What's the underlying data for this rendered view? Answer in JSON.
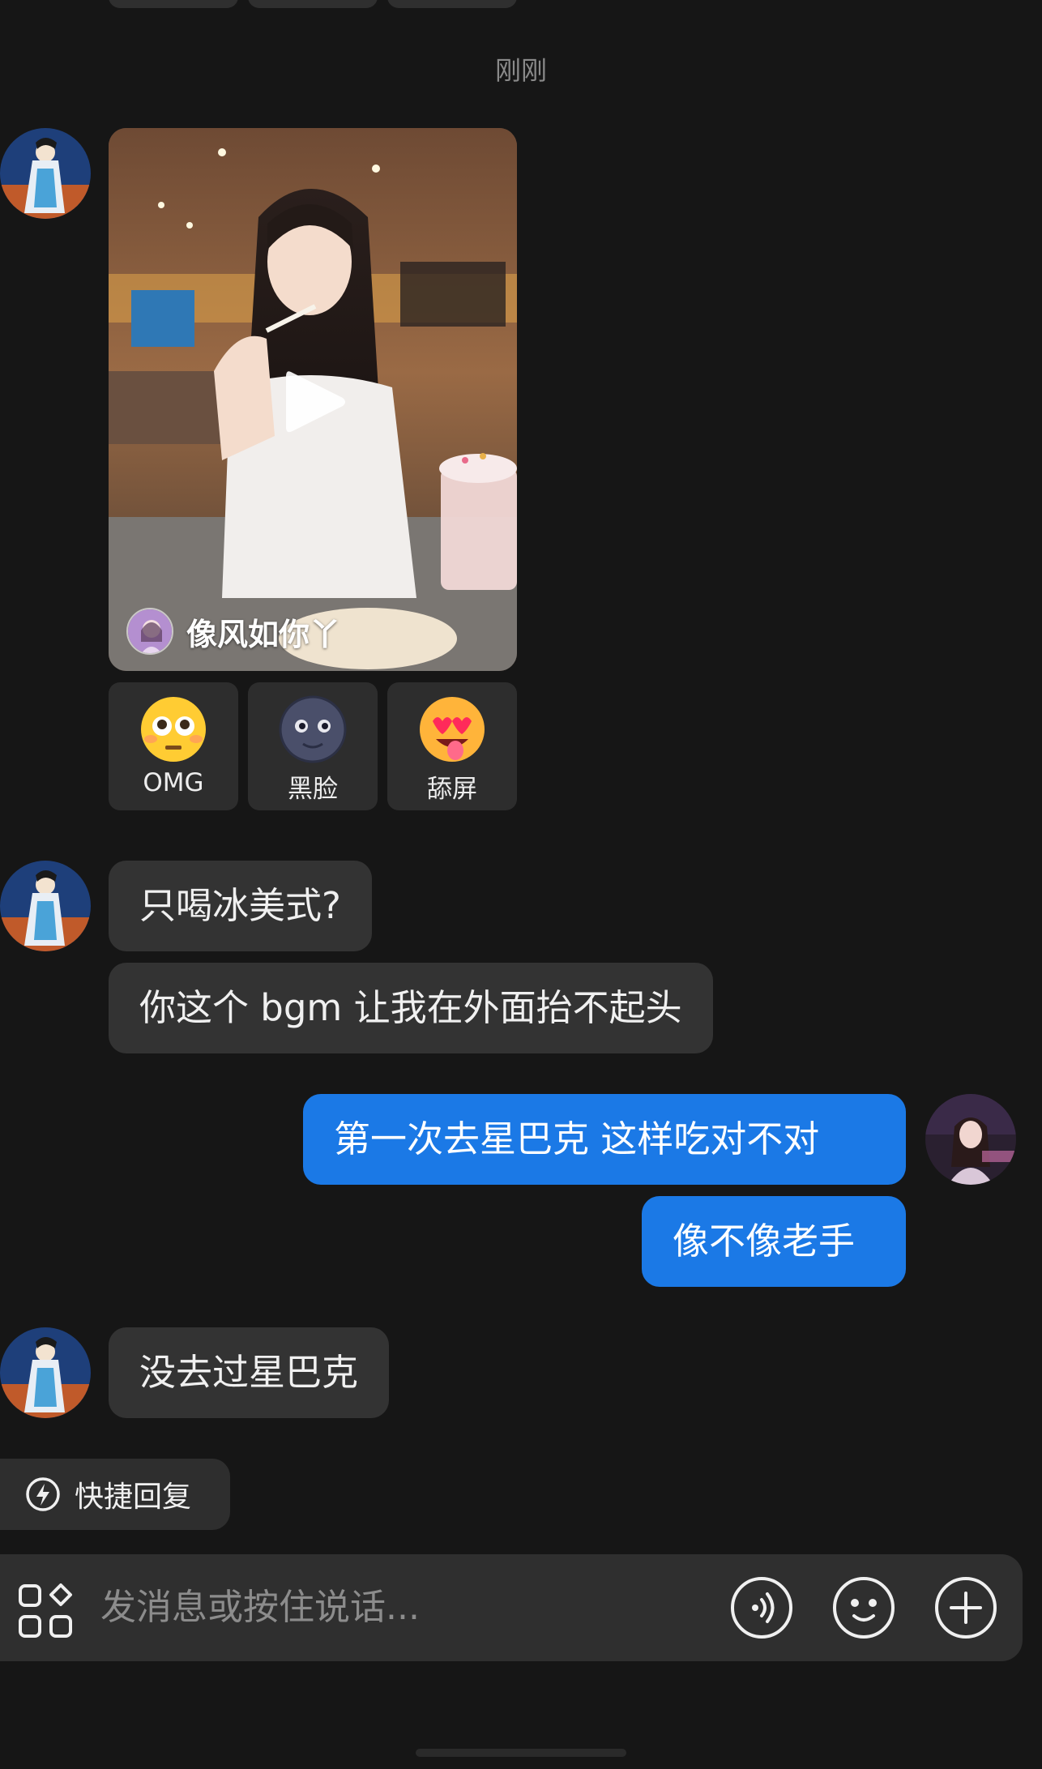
{
  "timestamp": "刚刚",
  "video_share": {
    "author_name": "像风如你丫",
    "play_icon": "play-icon"
  },
  "reactions": [
    {
      "label": "OMG",
      "emoji": "flushed-face"
    },
    {
      "label": "黑脸",
      "emoji": "new-moon-face"
    },
    {
      "label": "舔屏",
      "emoji": "heart-eyes-tongue-face"
    }
  ],
  "messages": {
    "in_1": "只喝冰美式?",
    "in_2": "你这个 bgm 让我在外面抬不起头",
    "out_1": "第一次去星巴克 这样吃对不对",
    "out_2": "像不像老手",
    "in_3": "没去过星巴克"
  },
  "quick_reply": {
    "label": "快捷回复",
    "icon": "lightning-icon"
  },
  "input_bar": {
    "placeholder": "发消息或按住说话...",
    "apps_icon": "apps-grid-icon",
    "voice_icon": "voice-icon",
    "emoji_icon": "emoji-icon",
    "plus_icon": "plus-icon"
  },
  "colors": {
    "background": "#161616",
    "incoming_bubble": "#333333",
    "outgoing_bubble": "#1b79e6"
  }
}
